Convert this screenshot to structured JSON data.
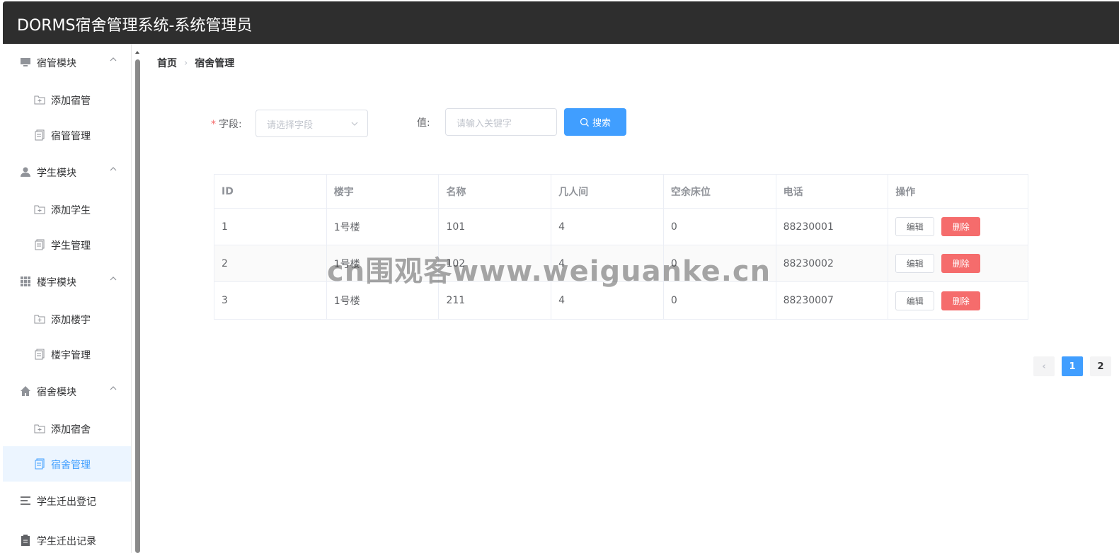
{
  "app": {
    "title": "DORMS宿舍管理系统-系统管理员"
  },
  "sidebar": {
    "groups": [
      {
        "label": "宿管模块",
        "icon": "monitor-icon",
        "items": [
          "添加宿管",
          "宿管管理"
        ]
      },
      {
        "label": "学生模块",
        "icon": "user-icon",
        "items": [
          "添加学生",
          "学生管理"
        ]
      },
      {
        "label": "楼宇模块",
        "icon": "grid-icon",
        "items": [
          "添加楼宇",
          "楼宇管理"
        ]
      },
      {
        "label": "宿舍模块",
        "icon": "home-icon",
        "items": [
          "添加宿舍",
          "宿舍管理"
        ]
      }
    ],
    "extra": [
      {
        "label": "学生迁出登记",
        "icon": "list-icon"
      },
      {
        "label": "学生迁出记录",
        "icon": "clipboard-icon"
      }
    ],
    "active_item": "宿舍管理"
  },
  "breadcrumb": {
    "home": "首页",
    "current": "宿舍管理"
  },
  "search": {
    "field_label": "字段:",
    "field_placeholder": "请选择字段",
    "value_label": "值:",
    "value_placeholder": "请输入关键字",
    "button_label": "搜索"
  },
  "table": {
    "columns": [
      "ID",
      "楼宇",
      "名称",
      "几人间",
      "空余床位",
      "电话",
      "操作"
    ],
    "rows": [
      [
        "1",
        "1号楼",
        "101",
        "4",
        "0",
        "88230001"
      ],
      [
        "2",
        "1号楼",
        "102",
        "4",
        "0",
        "88230002"
      ],
      [
        "3",
        "1号楼",
        "211",
        "4",
        "0",
        "88230007"
      ]
    ],
    "edit_label": "编辑",
    "delete_label": "删除"
  },
  "pagination": {
    "prev": "‹",
    "pages": [
      "1",
      "2"
    ],
    "current": "1"
  },
  "watermark": "cn围观客www.weiguanke.cn",
  "colors": {
    "primary": "#409eff",
    "danger": "#f56c6c",
    "header": "#2e2e2e"
  }
}
